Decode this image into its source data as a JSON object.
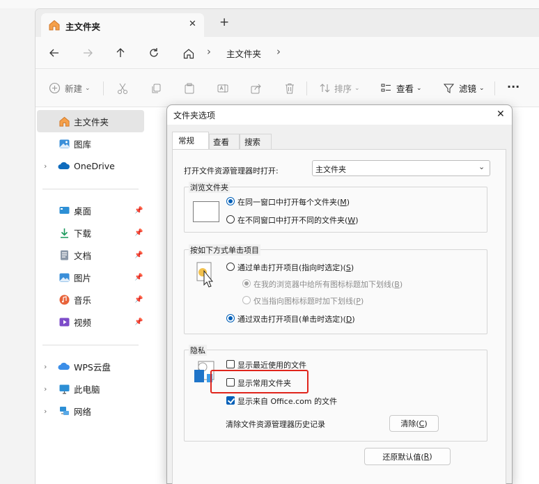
{
  "tab": {
    "title": "主文件夹",
    "close": "✕",
    "new_tab": "+"
  },
  "nav": {
    "breadcrumb_current": "主文件夹",
    "separator": "›"
  },
  "toolbar": {
    "new_label": "新建",
    "sort_label": "排序",
    "view_label": "查看",
    "filter_label": "滤镜",
    "more": "···"
  },
  "sidebar": {
    "items": [
      {
        "label": "主文件夹",
        "icon": "home-icon",
        "selected": true
      },
      {
        "label": "图库",
        "icon": "gallery-icon"
      },
      {
        "label": "OneDrive",
        "icon": "onedrive-icon",
        "expandable": true
      },
      {
        "label": "桌面",
        "icon": "desktop-icon",
        "pinned": true
      },
      {
        "label": "下载",
        "icon": "download-icon",
        "pinned": true
      },
      {
        "label": "文档",
        "icon": "document-icon",
        "pinned": true
      },
      {
        "label": "图片",
        "icon": "pictures-icon",
        "pinned": true
      },
      {
        "label": "音乐",
        "icon": "music-icon",
        "pinned": true
      },
      {
        "label": "视频",
        "icon": "video-icon",
        "pinned": true
      },
      {
        "label": "WPS云盘",
        "icon": "wps-cloud-icon",
        "expandable": true
      },
      {
        "label": "此电脑",
        "icon": "this-pc-icon",
        "expandable": true
      },
      {
        "label": "网络",
        "icon": "network-icon",
        "expandable": true
      }
    ]
  },
  "dialog": {
    "title": "文件夹选项",
    "tabs": [
      "常规",
      "查看",
      "搜索"
    ],
    "open_explorer_label": "打开文件资源管理器时打开:",
    "open_explorer_value": "主文件夹",
    "browse": {
      "legend": "浏览文件夹",
      "opt_same": "在同一窗口中打开每个文件夹(",
      "opt_same_key": "M",
      "opt_new": "在不同窗口中打开不同的文件夹(",
      "opt_new_key": "W"
    },
    "click": {
      "legend": "按如下方式单击项目",
      "opt_single": "通过单击打开项目(指向时选定)(",
      "opt_single_key": "S",
      "opt_underline_all": "在我的浏览器中给所有图标标题加下划线(",
      "opt_underline_all_key": "B",
      "opt_underline_hover": "仅当指向图标标题时加下划线(",
      "opt_underline_hover_key": "P",
      "opt_double": "通过双击打开项目(单击时选定)(",
      "opt_double_key": "D"
    },
    "privacy": {
      "legend": "隐私",
      "show_recent": "显示最近使用的文件",
      "show_frequent": "显示常用文件夹",
      "show_office": "显示来自 Office.com 的文件",
      "clear_history_label": "清除文件资源管理器历史记录",
      "clear_button": "清除(",
      "clear_key": "C"
    },
    "restore_button": "还原默认值(",
    "restore_key": "R",
    "close": "✕"
  },
  "colors": {
    "accent": "#005fb8",
    "highlight": "#e0241b"
  }
}
